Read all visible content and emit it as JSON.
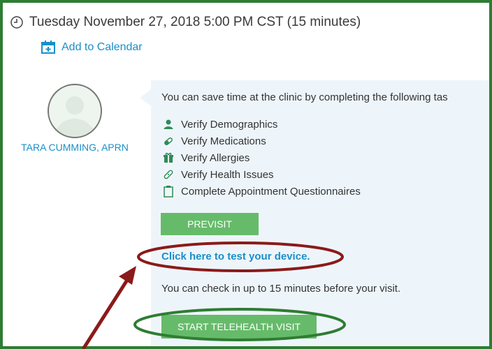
{
  "appointment": {
    "datetime": "Tuesday November 27, 2018 5:00 PM CST (15 minutes)",
    "add_calendar": "Add to Calendar"
  },
  "provider": {
    "name": "TARA CUMMING, APRN"
  },
  "previsit": {
    "intro": "You can save time at the clinic by completing the following tas",
    "tasks": [
      {
        "icon": "person-icon",
        "label": "Verify Demographics"
      },
      {
        "icon": "pill-icon",
        "label": "Verify Medications"
      },
      {
        "icon": "gift-icon",
        "label": "Verify Allergies"
      },
      {
        "icon": "bandage-icon",
        "label": "Verify Health Issues"
      },
      {
        "icon": "clipboard-icon",
        "label": "Complete Appointment Questionnaires"
      }
    ],
    "button": "PREVISIT"
  },
  "test_link": "Click here to test your device.",
  "checkin_note": "You can check in up to 15 minutes before your visit.",
  "telehealth_button": "START TELEHEALTH VISIT",
  "colors": {
    "frame": "#2e7d32",
    "accent_blue": "#1a8fc9",
    "button_green": "#66bb6a",
    "panel_bg": "#eef5fa",
    "highlight_red": "#8b1a1a",
    "highlight_green": "#2e7d32"
  }
}
